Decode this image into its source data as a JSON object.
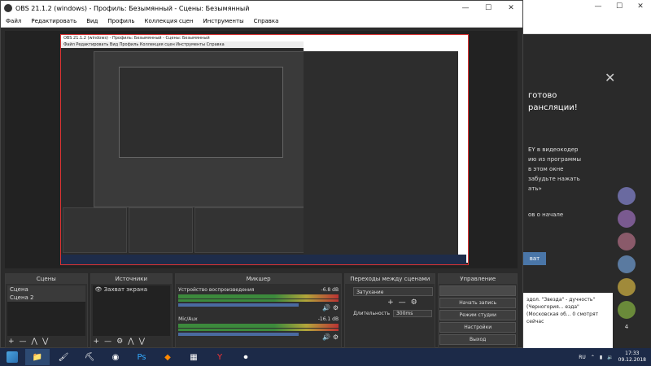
{
  "obs": {
    "title": "OBS 21.1.2 (windows) - Профиль: Безымянный - Сцены: Безымянный",
    "window_buttons": [
      "—",
      "☐",
      "✕"
    ],
    "menu": [
      "Файл",
      "Редактировать",
      "Вид",
      "Профиль",
      "Коллекция сцен",
      "Инструменты",
      "Справка"
    ],
    "nested_title": "OBS 21.1.2 (windows) - Профиль: Безымянный - Сцены: Безымянный",
    "scenes": {
      "header": "Сцены",
      "items": [
        "Сцена",
        "Сцена 2"
      ]
    },
    "sources": {
      "header": "Источники",
      "items": [
        "Захват экрана"
      ]
    },
    "mixer": {
      "header": "Микшер",
      "channels": [
        {
          "name": "Устройство воспроизведения",
          "db": "-6.8 dB"
        },
        {
          "name": "Mic/Aux",
          "db": "-16.1 dB"
        }
      ]
    },
    "transitions": {
      "header": "Переходы между сценами",
      "selected": "Затухание",
      "duration_label": "Длительность",
      "duration_value": "300ms"
    },
    "controls": {
      "header": "Управление",
      "buttons": [
        "Начать запись",
        "Режим студии",
        "Настройки",
        "Выход"
      ]
    },
    "toolbar_symbols": {
      "add": "+",
      "remove": "—",
      "up": "⋀",
      "down": "⋁",
      "gear": "⚙"
    }
  },
  "browser": {
    "window_buttons": [
      "—",
      "☐",
      "✕"
    ],
    "lines": [
      "готово",
      "рансляции!"
    ],
    "text_lines": [
      "EY в видеокодер",
      "ию из программы",
      "в этом окне",
      "забудьте нажать",
      "ать»",
      "ов о начале"
    ],
    "button_label": "ват",
    "news": "здол. \"Звезда\" - дучность\" (Черногория... ездa\" (Московская об... 0 смотрят сейчас",
    "avatar_badge": "4"
  },
  "taskbar": {
    "lang": "RU",
    "time": "17:33",
    "date": "09.12.2018"
  }
}
